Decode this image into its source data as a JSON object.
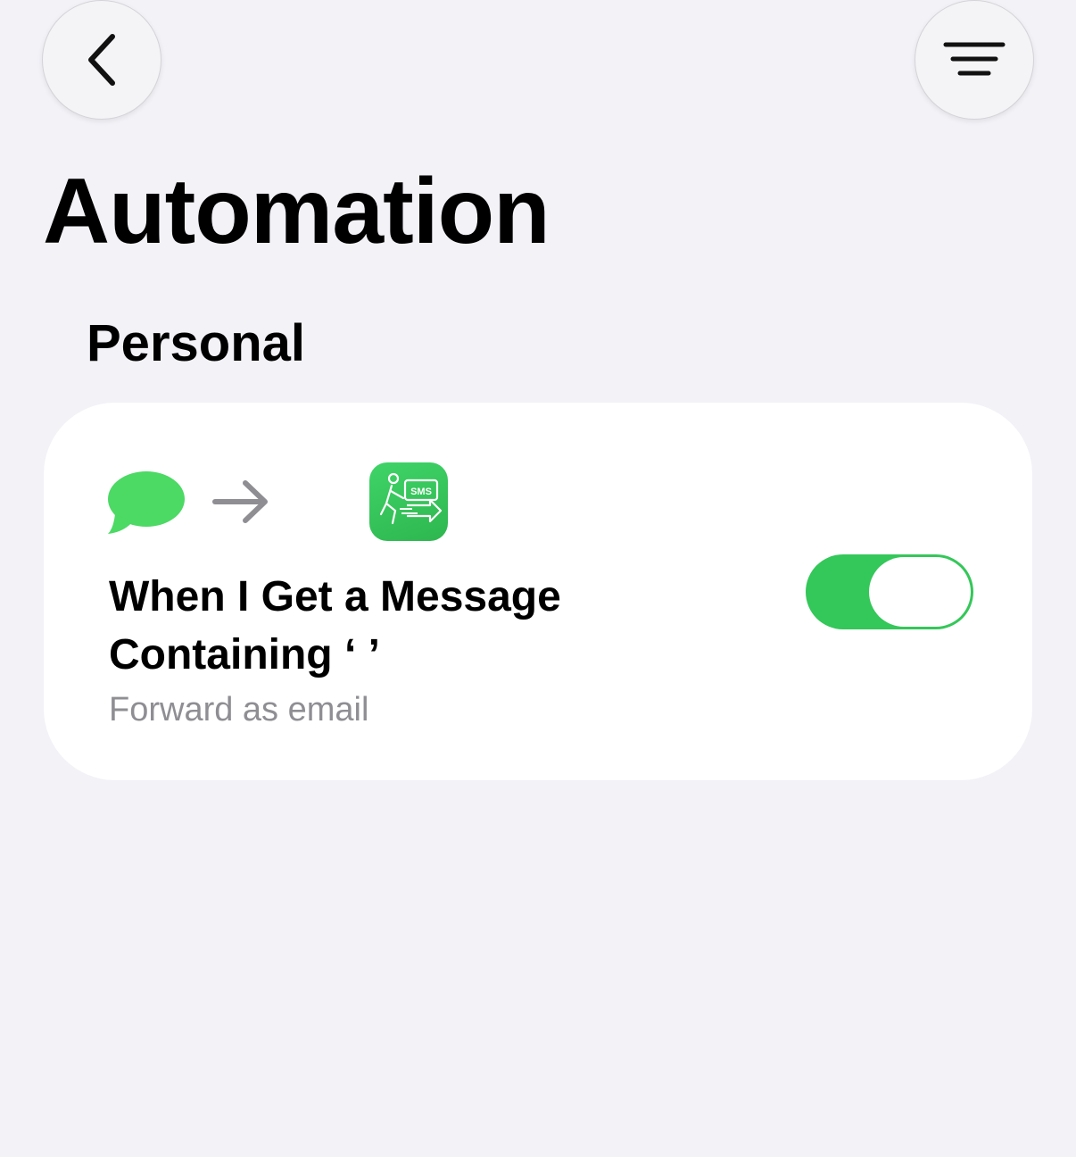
{
  "nav": {
    "back_icon": "chevron-left-icon",
    "filter_icon": "filter-lines-icon"
  },
  "page": {
    "title": "Automation",
    "section": "Personal"
  },
  "automation": {
    "trigger_icon": "message-bubble-icon",
    "arrow_icon": "arrow-right-icon",
    "action_icon": "sms-forward-app-icon",
    "action_icon_text": "SMS",
    "title": "When I Get a Message Containing ‘ ’",
    "subtitle": "Forward as email",
    "enabled": true
  },
  "colors": {
    "background": "#f2f2f7",
    "accent_green": "#34c759",
    "message_green": "#4cd964",
    "subtitle_gray": "#8e8e93"
  }
}
